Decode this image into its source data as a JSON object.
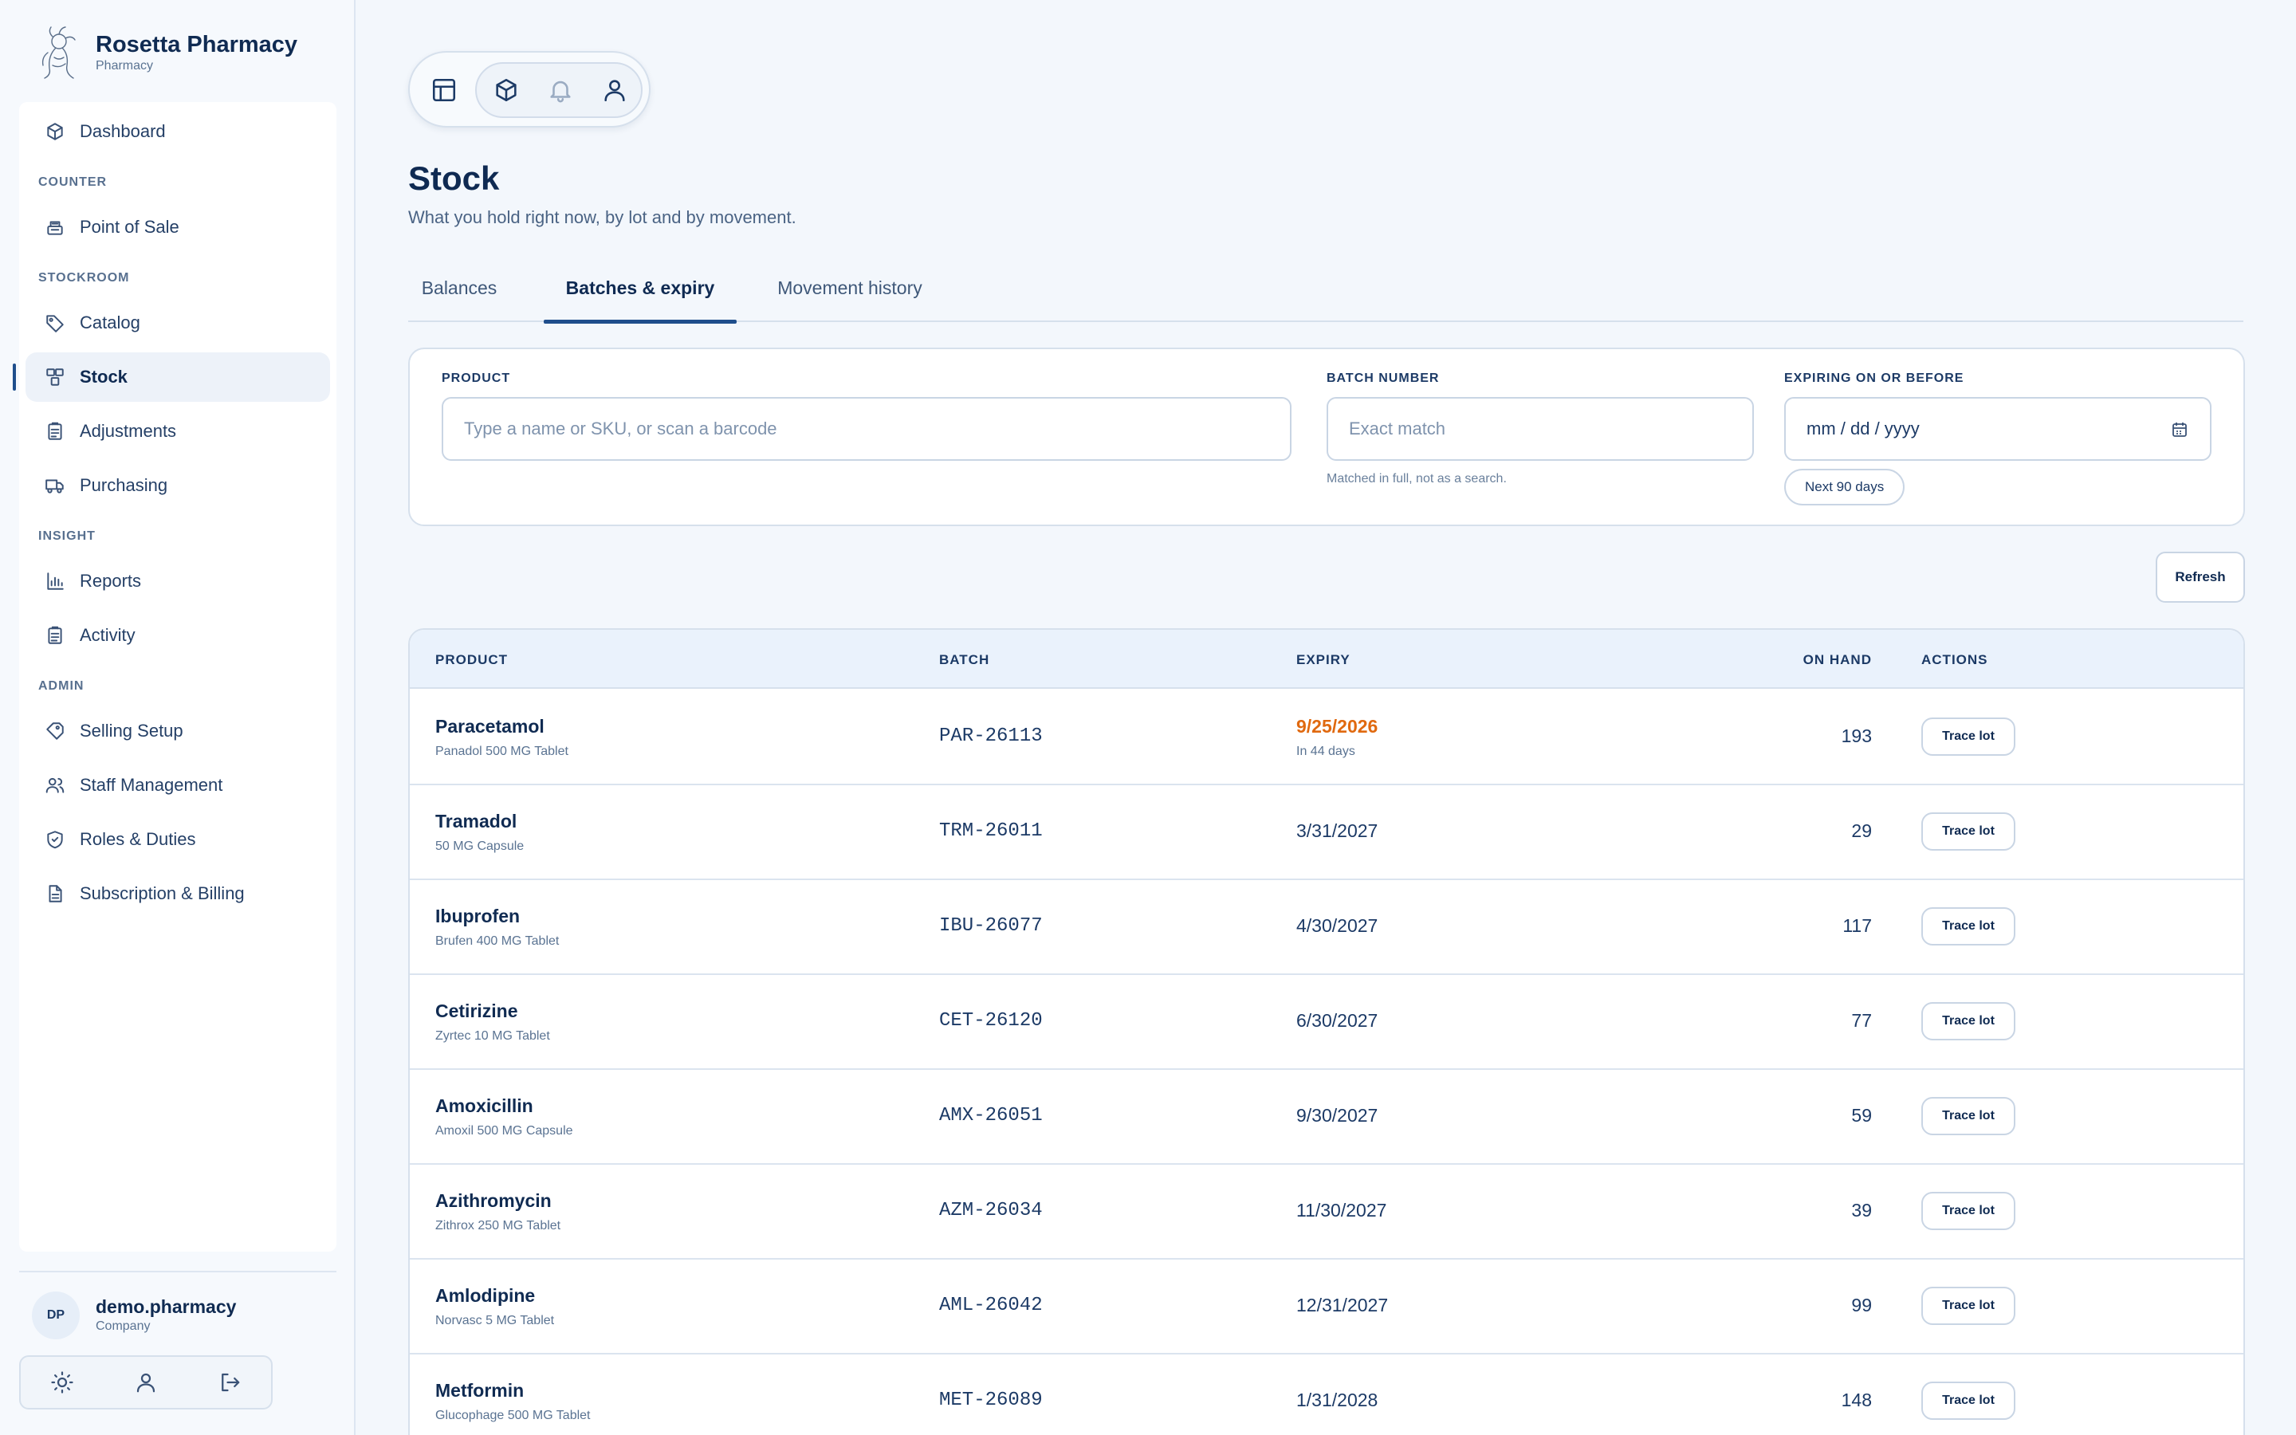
{
  "brand": {
    "name": "Rosetta Pharmacy",
    "subtitle": "Pharmacy"
  },
  "sidebar": {
    "sections": [
      "COUNTER",
      "STOCKROOM",
      "INSIGHT",
      "ADMIN"
    ],
    "items": [
      {
        "label": "Dashboard",
        "icon": "cube-icon"
      },
      {
        "label": "Point of Sale",
        "icon": "register-icon"
      },
      {
        "label": "Catalog",
        "icon": "tag-icon"
      },
      {
        "label": "Stock",
        "icon": "boxes-icon",
        "active": true
      },
      {
        "label": "Adjustments",
        "icon": "clipboard-icon"
      },
      {
        "label": "Purchasing",
        "icon": "truck-icon"
      },
      {
        "label": "Reports",
        "icon": "bar-chart-icon"
      },
      {
        "label": "Activity",
        "icon": "clipboard-list-icon"
      },
      {
        "label": "Selling Setup",
        "icon": "price-tag-icon"
      },
      {
        "label": "Staff Management",
        "icon": "users-icon"
      },
      {
        "label": "Roles & Duties",
        "icon": "shield-icon"
      },
      {
        "label": "Subscription & Billing",
        "icon": "document-icon"
      }
    ]
  },
  "user": {
    "initials": "DP",
    "name": "demo.pharmacy",
    "role": "Company"
  },
  "page": {
    "title": "Stock",
    "subtitle": "What you hold right now, by lot and by movement."
  },
  "tabs": [
    {
      "label": "Balances"
    },
    {
      "label": "Batches & expiry",
      "active": true
    },
    {
      "label": "Movement history"
    }
  ],
  "filters": {
    "product_label": "PRODUCT",
    "product_placeholder": "Type a name or SKU, or scan a barcode",
    "batch_label": "BATCH NUMBER",
    "batch_placeholder": "Exact match",
    "batch_hint": "Matched in full, not as a search.",
    "expiry_label": "EXPIRING ON OR BEFORE",
    "expiry_placeholder": "mm / dd / yyyy",
    "expiry_chip": "Next 90 days"
  },
  "refresh_label": "Refresh",
  "table": {
    "headers": {
      "product": "PRODUCT",
      "batch": "BATCH",
      "expiry": "EXPIRY",
      "on_hand": "ON HAND",
      "actions": "ACTIONS"
    },
    "action_label": "Trace lot",
    "rows": [
      {
        "name": "Paracetamol",
        "desc": "Panadol 500 MG Tablet",
        "batch": "PAR-26113",
        "expiry": "9/25/2026",
        "expiry_note": "In 44 days",
        "qty": "193",
        "warn": true
      },
      {
        "name": "Tramadol",
        "desc": "50 MG Capsule",
        "batch": "TRM-26011",
        "expiry": "3/31/2027",
        "expiry_note": "",
        "qty": "29"
      },
      {
        "name": "Ibuprofen",
        "desc": "Brufen 400 MG Tablet",
        "batch": "IBU-26077",
        "expiry": "4/30/2027",
        "expiry_note": "",
        "qty": "117"
      },
      {
        "name": "Cetirizine",
        "desc": "Zyrtec 10 MG Tablet",
        "batch": "CET-26120",
        "expiry": "6/30/2027",
        "expiry_note": "",
        "qty": "77"
      },
      {
        "name": "Amoxicillin",
        "desc": "Amoxil 500 MG Capsule",
        "batch": "AMX-26051",
        "expiry": "9/30/2027",
        "expiry_note": "",
        "qty": "59"
      },
      {
        "name": "Azithromycin",
        "desc": "Zithrox 250 MG Tablet",
        "batch": "AZM-26034",
        "expiry": "11/30/2027",
        "expiry_note": "",
        "qty": "39"
      },
      {
        "name": "Amlodipine",
        "desc": "Norvasc 5 MG Tablet",
        "batch": "AML-26042",
        "expiry": "12/31/2027",
        "expiry_note": "",
        "qty": "99"
      },
      {
        "name": "Metformin",
        "desc": "Glucophage 500 MG Tablet",
        "batch": "MET-26089",
        "expiry": "1/31/2028",
        "expiry_note": "",
        "qty": "148"
      }
    ]
  },
  "colors": {
    "accent": "#1f4e8c",
    "warning": "#e0690f",
    "background": "#f3f7fc"
  }
}
